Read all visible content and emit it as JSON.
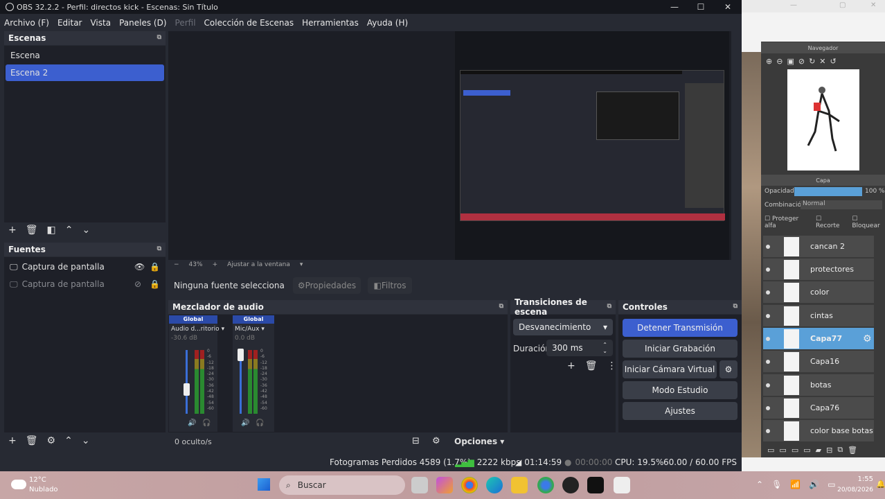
{
  "window": {
    "title": "OBS 32.2.2 - Perfil: directos kick - Escenas: Sin Título"
  },
  "menu": [
    "Archivo (F)",
    "Editar",
    "Vista",
    "Paneles (D)",
    "Perfil",
    "Colección de Escenas",
    "Herramientas",
    "Ayuda (H)"
  ],
  "scenes": {
    "title": "Escenas",
    "items": [
      "Escena",
      "Escena 2"
    ],
    "selected": 1
  },
  "sources": {
    "title": "Fuentes",
    "items": [
      "Captura de pantalla",
      "Captura de pantalla"
    ]
  },
  "preview": {
    "zoom": "43%",
    "fit": "Ajustar a la ventana"
  },
  "context": {
    "no_source": "Ninguna fuente selecciona",
    "properties": "Propiedades",
    "filters": "Filtros"
  },
  "mixer": {
    "title": "Mezclador de audio",
    "channels": [
      {
        "global": "Global",
        "name": "Audio d...ritorio",
        "db": "-30.6 dB"
      },
      {
        "global": "Global",
        "name": "Mic/Aux",
        "db": "0.0 dB"
      }
    ],
    "scale": [
      "0",
      "-6",
      "-12",
      "-18",
      "-24",
      "-30",
      "-36",
      "-42",
      "-48",
      "-54",
      "-60"
    ],
    "hidden": "0 oculto/s",
    "options": "Opciones"
  },
  "transitions": {
    "title": "Transiciones de escena",
    "type": "Desvanecimiento",
    "duration_label": "Duración",
    "duration_value": "300 ms"
  },
  "controls": {
    "title": "Controles",
    "stop_stream": "Detener Transmisión",
    "start_rec": "Iniciar Grabación",
    "virtual_cam": "Iniciar Cámara Virtual",
    "studio": "Modo Estudio",
    "settings": "Ajustes"
  },
  "statusbar": {
    "dropped": "Fotogramas Perdidos 4589 (1.7%)",
    "kbps": "2222 kbps",
    "stream_time": "01:14:59",
    "rec_time": "00:00:00",
    "cpu": "CPU: 19.5%",
    "fps": "60.00 / 60.00 FPS"
  },
  "rightapp": {
    "navigator": "Navegador",
    "layers_title": "Capa",
    "opacity_label": "Opacidad",
    "opacity_value": "100 %",
    "blend_label": "Combinación",
    "blend_value": "Normal",
    "protect_alpha": "Proteger alfa",
    "clip": "Recorte",
    "lock": "Bloquear",
    "layers": [
      "cancan 2",
      "protectores",
      "color",
      "cintas",
      "Capa77",
      "Capa16",
      "botas",
      "Capa76",
      "color base botas"
    ],
    "selected_layer": "Capa77"
  },
  "taskbar": {
    "temp": "12°C",
    "weather": "Nublado",
    "search": "Buscar",
    "time": "1:55",
    "date": "20/08/2026"
  }
}
